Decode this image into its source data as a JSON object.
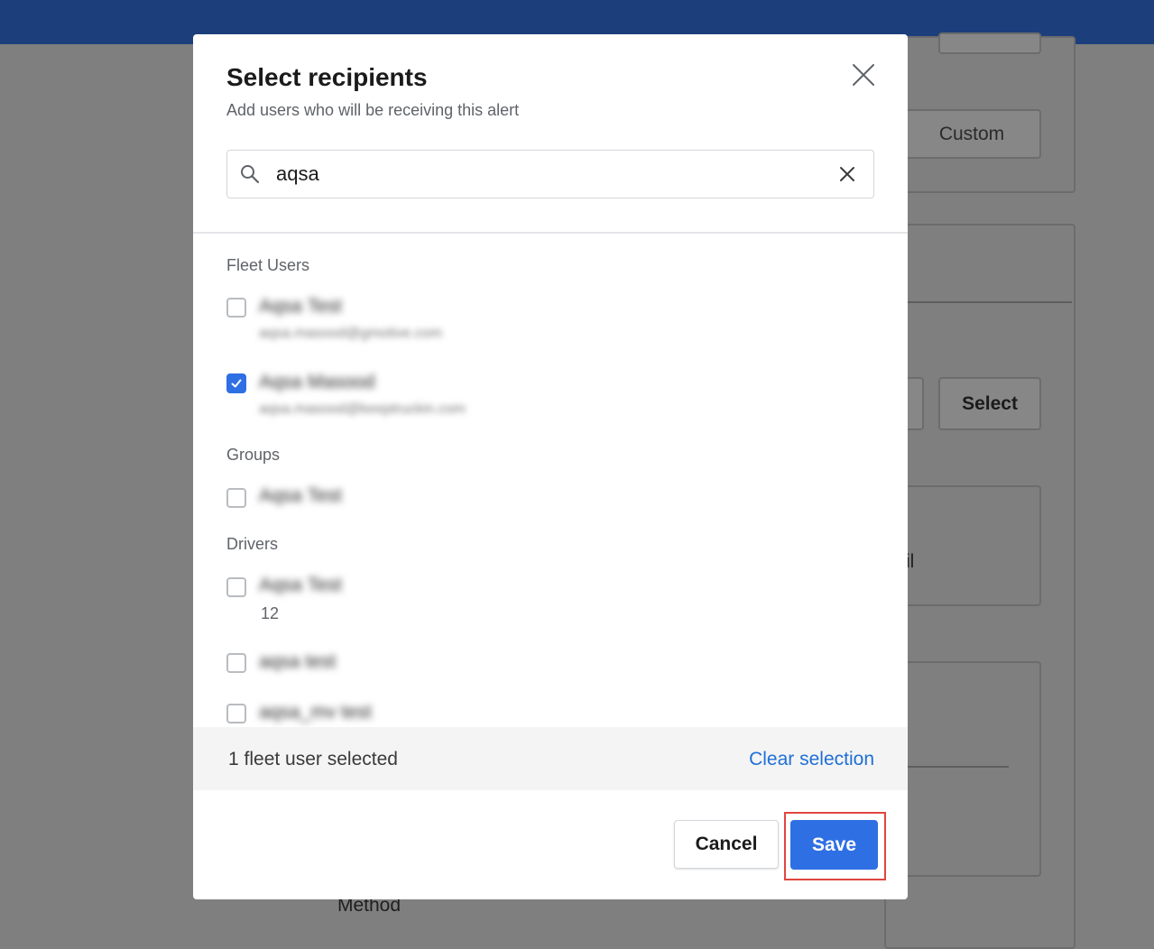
{
  "background": {
    "custom_button": "Custom",
    "select_button": "Select",
    "partial_text_email": "il",
    "partial_text_method": "Method"
  },
  "modal": {
    "title": "Select recipients",
    "subtitle": "Add users who will be receiving this alert",
    "search": {
      "value": "aqsa"
    },
    "sections": {
      "fleet_users": {
        "label": "Fleet Users",
        "items": [
          {
            "name": "Aqsa Test",
            "email": "aqsa.masood@gmotive.com",
            "checked": false
          },
          {
            "name": "Aqsa Masood",
            "email": "aqsa.masood@keeptruckin.com",
            "checked": true
          }
        ]
      },
      "groups": {
        "label": "Groups",
        "items": [
          {
            "name": "Aqsa Test",
            "checked": false
          }
        ]
      },
      "drivers": {
        "label": "Drivers",
        "items": [
          {
            "name": "Aqsa Test",
            "sub": "12",
            "checked": false
          },
          {
            "name": "aqsa test",
            "checked": false
          },
          {
            "name": "aqsa_mv test",
            "checked": false
          }
        ]
      }
    },
    "footer": {
      "selected_count": "1 fleet user selected",
      "clear_selection": "Clear selection"
    },
    "buttons": {
      "cancel": "Cancel",
      "save": "Save"
    }
  },
  "colors": {
    "header": "#1c3f7c",
    "accent": "#2f6fe4",
    "link": "#1f6fd6",
    "highlight": "#e0453f"
  },
  "icons": [
    "close-icon",
    "search-icon",
    "clear-search-icon",
    "checkmark-icon"
  ]
}
